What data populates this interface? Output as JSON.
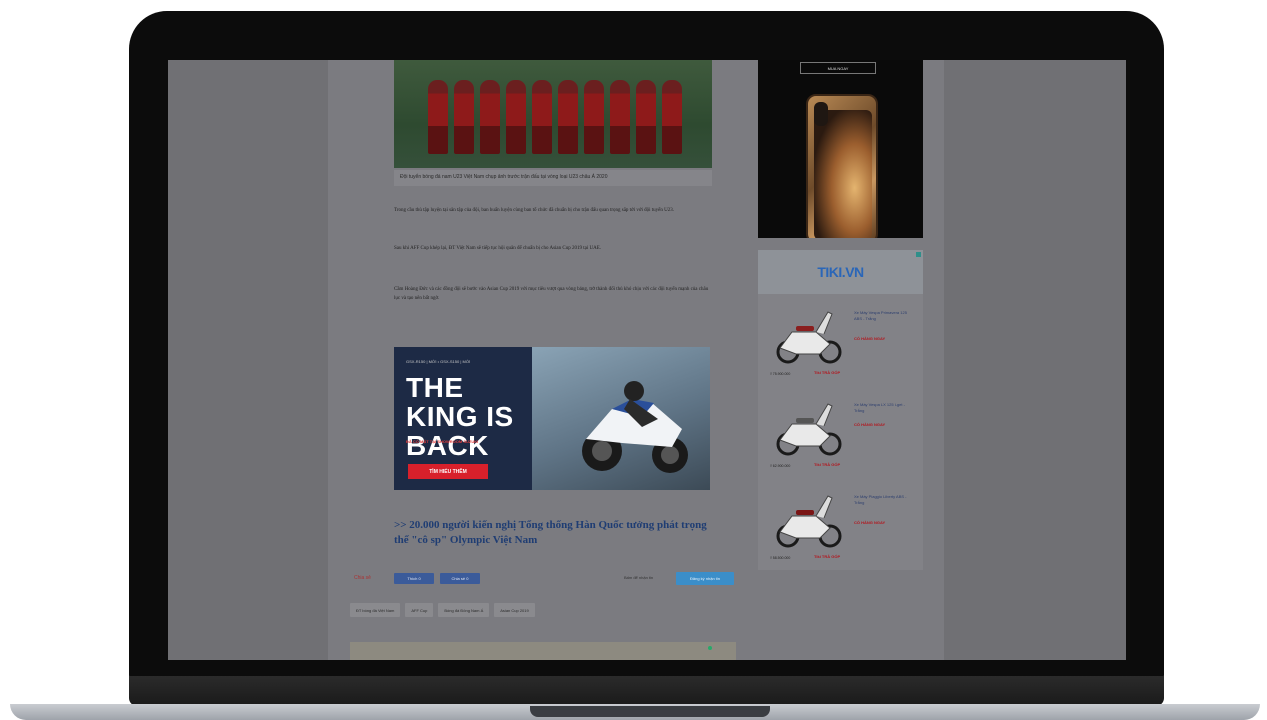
{
  "article": {
    "caption": "Đội tuyển bóng đá nam U23 Việt Nam chụp ảnh trước trận đấu tại vòng loại U23 châu Á 2020",
    "paragraphs": [
      "Trong cầu thủ tập luyện tại sân tập của đội, ban huấn luyện cùng ban tổ chức đã chuẩn bị cho trận đấu quan trọng sắp tới với đội tuyển U23.",
      "Sau khi AFF Cup khép lại, ĐT Việt Nam sẽ tiếp tục hội quân để chuẩn bị cho Asian Cup 2019 tại UAE.",
      "Cầm Hoàng Đức và các đồng đội sẽ bước vào Asian Cup 2019 với mục tiêu vượt qua vòng bảng, trở thành đối thủ khó chịu với các đội tuyển mạnh của châu lục và tạo nên bất ngờ."
    ],
    "related_link": ">> 20.000 người kiến nghị Tổng thống Hàn Quốc tưởng phát trọng thể \"cô sp\" Olympic Việt Nam"
  },
  "ad_motorcycle": {
    "topline": "GSX-R150 | MỚI   •   GSX-S150 | MỚI",
    "headline": "THE KING IS BACK",
    "subline": "ĐÃ CÓ MẶT TẠI SHOWROOM SUZUKI",
    "cta": "TÌM HIỂU THÊM"
  },
  "share": {
    "label": "Chia sẻ",
    "like_label": "Thích 0",
    "share_label": "Chia sẻ 0",
    "news_label": "Bấm để nhận tin",
    "news_button": "Đăng ký nhận tin"
  },
  "tags": [
    "ĐT bóng đá Việt Nam",
    "AFF Cup",
    "Bóng đá Đông Nam Á",
    "Asian Cup 2019"
  ],
  "sidebar": {
    "phone_ad_button": "MUA NGAY",
    "tiki_logo": "TIKI.VN",
    "products": [
      {
        "name": "Xe Máy Vespa Primavera 125 ABS - Trắng",
        "cta": "CÓ HÀNG NGAY",
        "price": "₫ 75.900.000",
        "price_red": "Tiki TRẢ GÓP"
      },
      {
        "name": "Xe Máy Vespa LX 125 i-get - Trắng",
        "cta": "CÓ HÀNG NGAY",
        "price": "₫ 62.900.000",
        "price_red": "Tiki TRẢ GÓP"
      },
      {
        "name": "Xe Máy Piaggio Liberty ABS - Trắng",
        "cta": "CÓ HÀNG NGAY",
        "price": "₫ 58.500.000",
        "price_red": "Tiki TRẢ GÓP"
      }
    ]
  }
}
